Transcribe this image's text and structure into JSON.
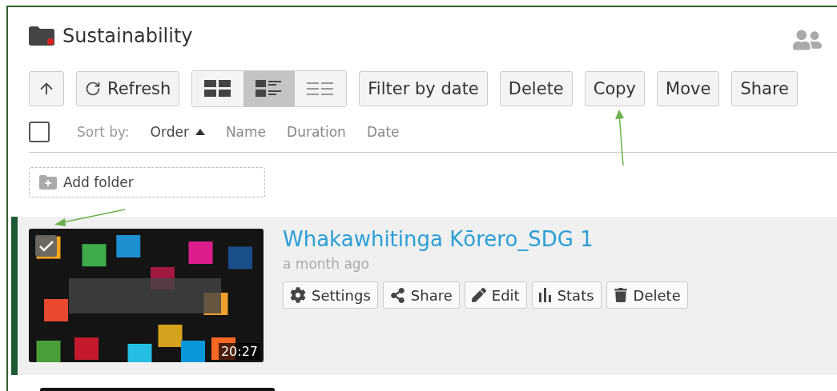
{
  "folder": {
    "title": "Sustainability"
  },
  "toolbar": {
    "refresh": "Refresh",
    "view_modes": [
      {
        "kind": "grid",
        "selected": false
      },
      {
        "kind": "detail",
        "selected": true
      },
      {
        "kind": "list",
        "selected": false
      }
    ],
    "buttons": [
      "Filter by date",
      "Delete",
      "Copy",
      "Move",
      "Share"
    ]
  },
  "sort": {
    "select_all_checked": false,
    "label": "Sort by:",
    "options": [
      {
        "label": "Order",
        "selected": true
      },
      {
        "label": "Name",
        "selected": false
      },
      {
        "label": "Duration",
        "selected": false
      },
      {
        "label": "Date",
        "selected": false
      }
    ]
  },
  "add_folder": "Add folder",
  "items": [
    {
      "title": "Whakawhitinga Kōrero_SDG 1",
      "age": "a month ago",
      "duration": "20:27",
      "checked": true,
      "selected": true,
      "actions": [
        {
          "kind": "settings",
          "label": "Settings"
        },
        {
          "kind": "share",
          "label": "Share"
        },
        {
          "kind": "edit",
          "label": "Edit"
        },
        {
          "kind": "stats",
          "label": "Stats"
        },
        {
          "kind": "delete",
          "label": "Delete"
        }
      ]
    }
  ]
}
